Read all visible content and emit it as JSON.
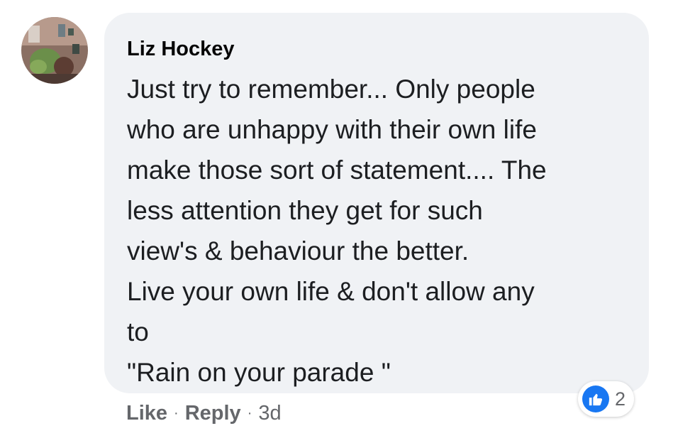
{
  "comment": {
    "author": "Liz Hockey",
    "lines": [
      "Just try to remember... Only people",
      "who are unhappy with their own life",
      "make those sort of statement.... The",
      "less attention they get for such",
      "view's & behaviour the better.",
      "Live your own life & don't allow any",
      "to",
      "\"Rain on your parade \""
    ]
  },
  "actions": {
    "like_label": "Like",
    "reply_label": "Reply",
    "separator": "·",
    "timestamp": "3d"
  },
  "reactions": {
    "icon": "thumbs-up-icon",
    "count": "2",
    "color": "#1877f2"
  },
  "colors": {
    "bubble": "#f0f2f5",
    "secondary_text": "#65676b"
  }
}
